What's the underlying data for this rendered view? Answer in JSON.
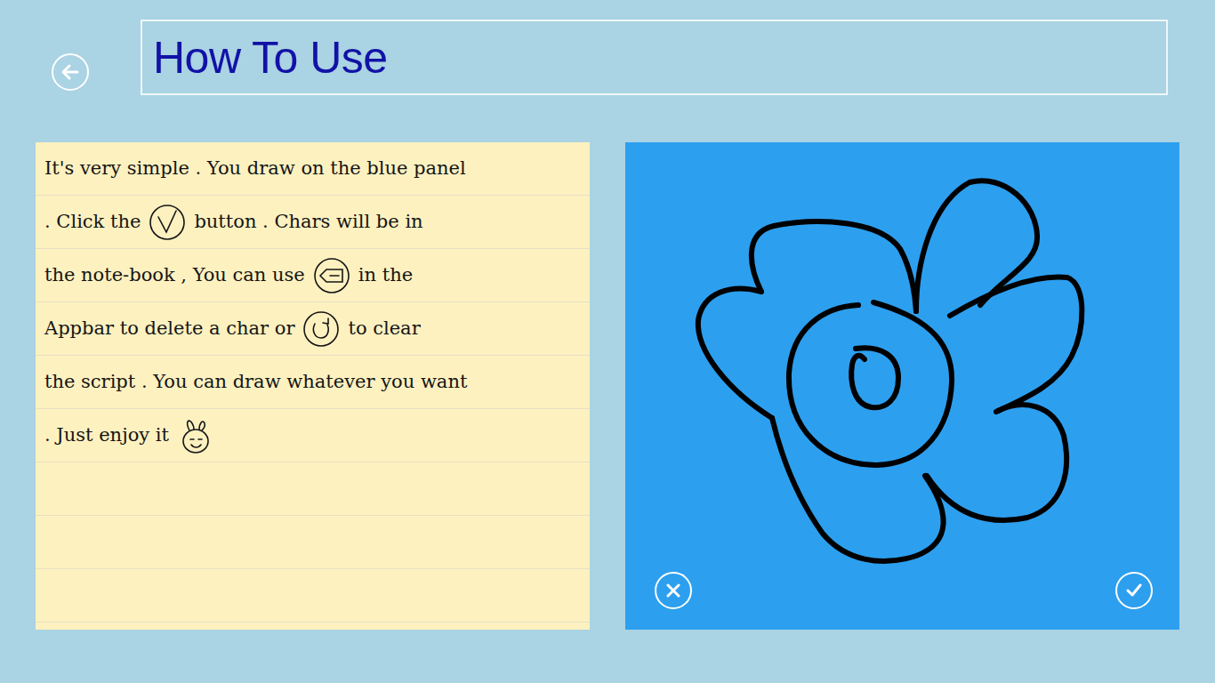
{
  "page": {
    "title": "How To Use"
  },
  "notebook": {
    "lines": [
      [
        {
          "kind": "text",
          "text": "It's very simple . You draw on the blue panel"
        }
      ],
      [
        {
          "kind": "text",
          "text": ". Click the"
        },
        {
          "kind": "check"
        },
        {
          "kind": "text",
          "text": "button . Chars will be in"
        }
      ],
      [
        {
          "kind": "text",
          "text": "the note-book , You can use"
        },
        {
          "kind": "backspace"
        },
        {
          "kind": "text",
          "text": "in the"
        }
      ],
      [
        {
          "kind": "text",
          "text": "Appbar to delete a char or"
        },
        {
          "kind": "refresh"
        },
        {
          "kind": "text",
          "text": "to clear"
        }
      ],
      [
        {
          "kind": "text",
          "text": "the script . You can draw whatever you want"
        }
      ],
      [
        {
          "kind": "text",
          "text": ". Just enjoy it"
        },
        {
          "kind": "bunny"
        }
      ]
    ]
  }
}
